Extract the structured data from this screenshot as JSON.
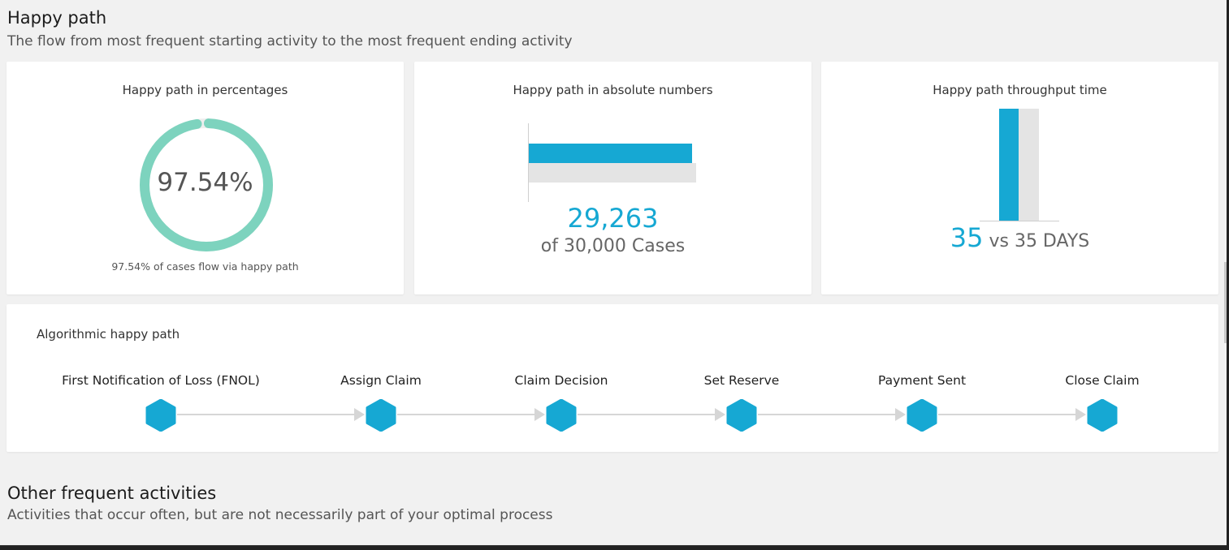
{
  "header": {
    "title": "Happy path",
    "subtitle": "The flow from most frequent starting activity to the most frequent ending activity"
  },
  "cards": {
    "percentage": {
      "title": "Happy path in percentages",
      "value_label": "97.54%",
      "value_fraction": 0.9754,
      "caption": "97.54% of cases flow via happy path",
      "ring_color": "#7dd3be"
    },
    "absolute": {
      "title": "Happy path in absolute numbers",
      "value": "29,263",
      "total": "of 30,000 Cases",
      "happy_cases": 29263,
      "total_cases": 30000,
      "bar_color": "#16a8d3",
      "total_bar_color": "#e4e4e4"
    },
    "throughput": {
      "title": "Happy path throughput time",
      "value": "35",
      "comparison": "vs 35 DAYS",
      "happy_days": 35,
      "all_days": 35
    }
  },
  "algorithmic": {
    "title": "Algorithmic happy path",
    "node_color": "#16a8d3",
    "steps": [
      {
        "label": "First Notification of Loss (FNOL)"
      },
      {
        "label": "Assign Claim"
      },
      {
        "label": "Claim Decision"
      },
      {
        "label": "Set Reserve"
      },
      {
        "label": "Payment Sent"
      },
      {
        "label": "Close Claim"
      }
    ]
  },
  "other": {
    "title": "Other frequent activities",
    "subtitle": "Activities that occur often, but are not necessarily part of your optimal process"
  }
}
